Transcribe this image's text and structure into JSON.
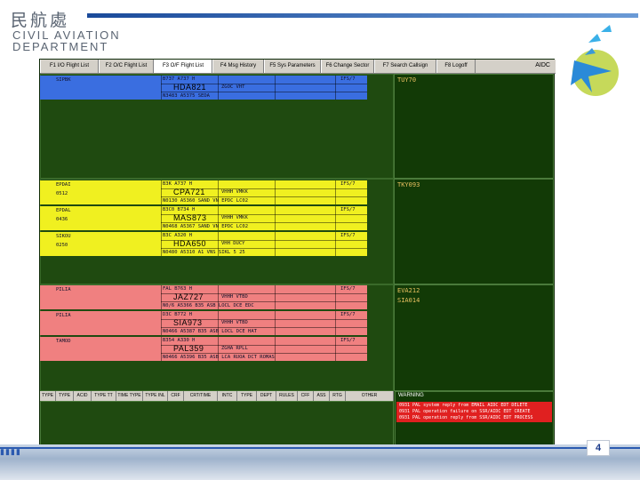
{
  "header": {
    "logo_chinese": "民航處",
    "logo_line1": "CIVIL AVIATION",
    "logo_line2": "DEPARTMENT"
  },
  "footer": {
    "slide_number": "4"
  },
  "app": {
    "window_tag": "AIDC",
    "tabs": [
      "F1  I/O Flight List",
      "F2  O/C Flight List",
      "F3  O/F Flight List",
      "F4  Msg History",
      "F5  Sys Parameters",
      "F6  Change Sector",
      "F7  Search Callsign",
      "F8  Logoff"
    ],
    "active_tab_index": 2,
    "right_panels": [
      "TUY70",
      "TKY093",
      "EVA212",
      "SIA014"
    ],
    "strip_groups": [
      {
        "color": "#3a6ee0",
        "strips": [
          {
            "left_top": "SIPBK",
            "left_bot": "",
            "line1": "B737    A737    H",
            "callsign": "HDA821",
            "line3": "N3483    A5375    SEDA",
            "route": "ZGOC     VHT",
            "eta": "IFS/7"
          }
        ]
      },
      {
        "color": "#f0f020",
        "strips": [
          {
            "left_top": "EPDAI",
            "left_bot": "0512",
            "line1": "B3K    A737    H",
            "callsign": "CPA721",
            "line3": "N0130    A5360    SAND VN EPDC LC02",
            "route": "VHHH     VMKK",
            "eta": "IFS/7"
          },
          {
            "left_top": "EPDAL",
            "left_bot": "0436",
            "line1": "B3C0    B734    H",
            "callsign": "MAS873",
            "line3": "N0468    A5367    SAND VN EPDC LC02",
            "route": "VHHH     VMKK",
            "eta": "IFS/7"
          },
          {
            "left_top": "SIKOU",
            "left_bot": "0250",
            "line1": "B3C    A320    H",
            "callsign": "HDA650",
            "line3": "N0480    A5310    A1   VNS SIKL 5 25",
            "route": "VHH     DUCY",
            "eta": "IFS/7"
          }
        ]
      },
      {
        "color": "#f08080",
        "strips": [
          {
            "left_top": "PILIA",
            "left_bot": "",
            "line1": "FAL    B763    H",
            "callsign": "JAZ727",
            "line3": "N0/6    A5366    B35 ASB LOCL DCE EDC",
            "route": "VHHH     VTBD",
            "eta": "IFS/7"
          },
          {
            "left_top": "PILIA",
            "left_bot": "",
            "line1": "D3C    B772    H",
            "callsign": "SIA973",
            "line3": "N0466    A5387    B35 ASB LOCL DCE HAT",
            "route": "VHHH     VTBD",
            "eta": "IFS/7"
          },
          {
            "left_top": "TAMOD",
            "left_bot": "",
            "line1": "B354    A330    H",
            "callsign": "PAL359",
            "line3": "N0466    A5396    B35 ASB LCA RUOA DCT ROMAS",
            "route": "ZGHA     RPLL",
            "eta": "IFS/7"
          }
        ]
      }
    ],
    "list_columns": [
      "TYPE",
      "TYPE",
      "ACID",
      "TYPE TT",
      "TIME TYPE",
      "TYPE INL",
      "CRF",
      "CRT/TIME",
      "INTC",
      "TYPE",
      "DEPT",
      "RULES",
      "CFF",
      "ASS",
      "RTG",
      "OTHER"
    ],
    "warnings_title": "WARNING",
    "warnings": [
      "0931  PAL system reply from EMAIL AIDC EDT DELETE",
      "0931  PAL operation failure on SSR/AIDC EDT CREATE",
      "0931  PAL operation reply from SSR/AIDC  EDT PROCESS"
    ]
  }
}
